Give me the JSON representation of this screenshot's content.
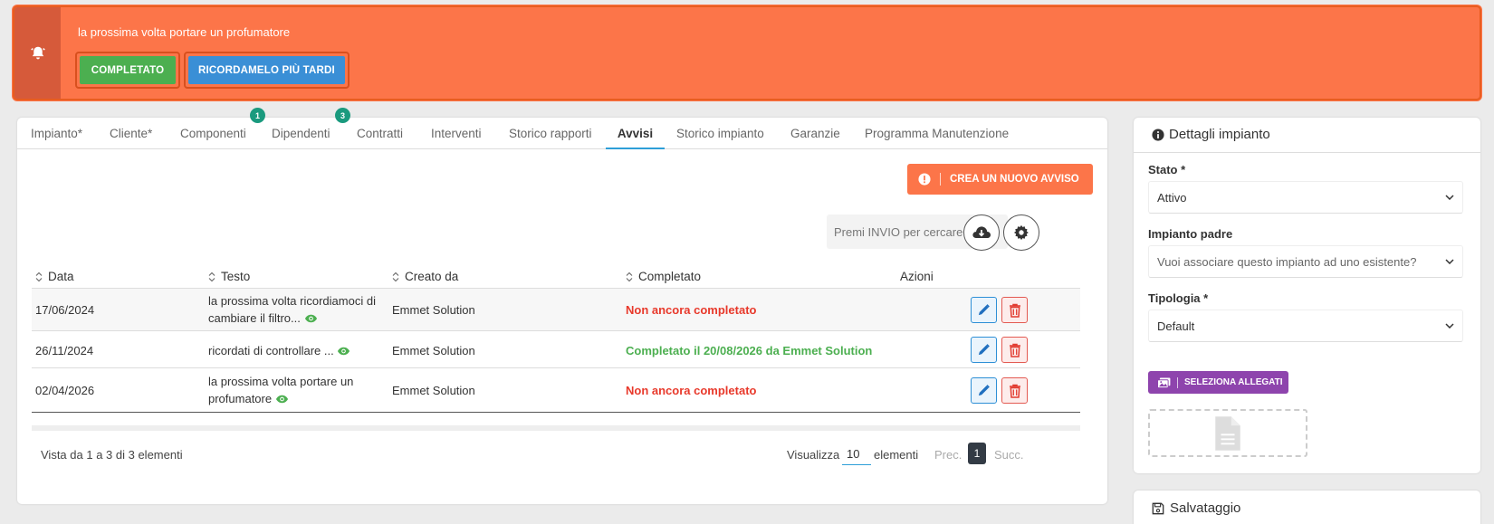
{
  "alert": {
    "message": "la prossima volta portare un profumatore",
    "done_label": "COMPLETATO",
    "later_label": "RICORDAMELO PIÙ TARDI",
    "icon": "bell-icon"
  },
  "tabs": [
    {
      "label": "Impianto*"
    },
    {
      "label": "Cliente*"
    },
    {
      "label": "Componenti"
    },
    {
      "label": "Dipendenti",
      "badge": "1"
    },
    {
      "label": "Contratti",
      "badge": "3"
    },
    {
      "label": "Interventi"
    },
    {
      "label": "Storico rapporti"
    },
    {
      "label": "Avvisi",
      "active": true
    },
    {
      "label": "Storico impianto"
    },
    {
      "label": "Garanzie"
    },
    {
      "label": "Programma Manutenzione"
    }
  ],
  "toolbar": {
    "new_label": "CREA UN NUOVO AVVISO",
    "search_placeholder": "Premi INVIO per cercare"
  },
  "table": {
    "columns": [
      "Data",
      "Testo",
      "Creato da",
      "Completato",
      "Azioni"
    ],
    "rows": [
      {
        "data": "17/06/2024",
        "testo": "la prossima volta ricordiamoci di cambiare il filtro...",
        "creato_da": "Emmet Solution",
        "completato": "Non ancora completato",
        "status": "pending"
      },
      {
        "data": "26/11/2024",
        "testo": "ricordati di controllare ...",
        "creato_da": "Emmet Solution",
        "completato": "Completato il 20/08/2026 da Emmet Solution",
        "status": "done"
      },
      {
        "data": "02/04/2026",
        "testo": "la prossima volta portare un profumatore",
        "creato_da": "Emmet Solution",
        "completato": "Non ancora completato",
        "status": "pending"
      }
    ]
  },
  "footer": {
    "info": "Vista da 1 a 3 di 3 elementi",
    "show_label": "Visualizza",
    "page_size": "10",
    "elements_label": "elementi",
    "prev": "Prec.",
    "page": "1",
    "next": "Succ."
  },
  "side": {
    "title": "Dettagli impianto",
    "stato_label": "Stato *",
    "stato_value": "Attivo",
    "padre_label": "Impianto padre",
    "padre_placeholder": "Vuoi associare questo impianto ad uno esistente?",
    "tipologia_label": "Tipologia *",
    "tipologia_value": "Default",
    "attach_label": "SELEZIONA ALLEGATI",
    "save_title": "Salvataggio"
  },
  "colors": {
    "alert": "#fc7549",
    "success": "#4caf50",
    "primary": "#3a8fd6",
    "danger": "#e8392b",
    "tab_active": "#2d9fd8",
    "badge": "#1a9a7e",
    "purple": "#8e44ad"
  }
}
